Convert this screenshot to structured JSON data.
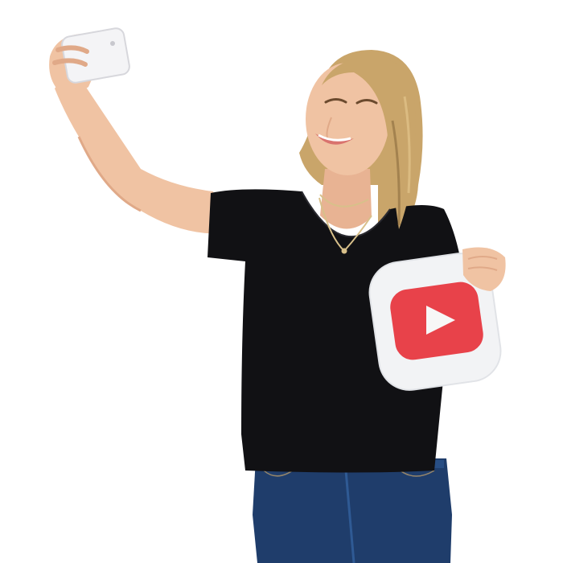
{
  "scene": {
    "background": "#ffffff",
    "subject": "woman-taking-selfie",
    "props": {
      "phone": {
        "icon": "smartphone-icon",
        "color": "#f4f4f6"
      },
      "sign": {
        "icon": "youtube-play-icon",
        "card_color": "#f2f3f5",
        "button_color": "#e8424a",
        "play_color": "#f7f7f7"
      }
    },
    "colors": {
      "skin": "#f0c3a3",
      "skin_shadow": "#e0a988",
      "hair": "#c9a56a",
      "hair_dark": "#8a6a3e",
      "shirt": "#111114",
      "jeans": "#1f3d6b",
      "jeans_light": "#2f5a94",
      "lips": "#d9736e"
    }
  }
}
